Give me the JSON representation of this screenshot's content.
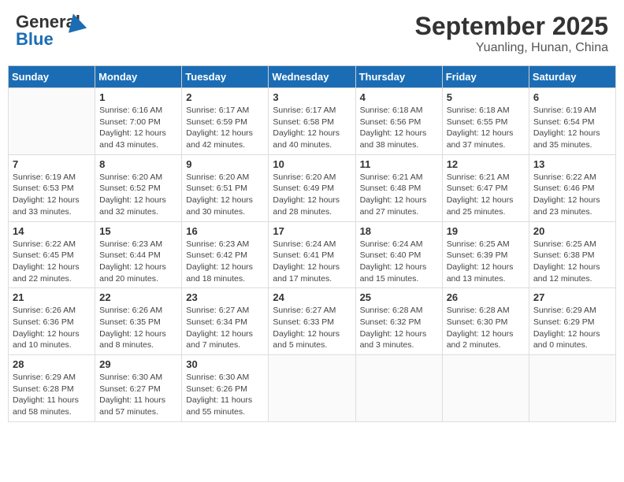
{
  "header": {
    "logo_general": "General",
    "logo_blue": "Blue",
    "title": "September 2025",
    "subtitle": "Yuanling, Hunan, China"
  },
  "weekdays": [
    "Sunday",
    "Monday",
    "Tuesday",
    "Wednesday",
    "Thursday",
    "Friday",
    "Saturday"
  ],
  "weeks": [
    [
      {
        "day": "",
        "detail": ""
      },
      {
        "day": "1",
        "detail": "Sunrise: 6:16 AM\nSunset: 7:00 PM\nDaylight: 12 hours\nand 43 minutes."
      },
      {
        "day": "2",
        "detail": "Sunrise: 6:17 AM\nSunset: 6:59 PM\nDaylight: 12 hours\nand 42 minutes."
      },
      {
        "day": "3",
        "detail": "Sunrise: 6:17 AM\nSunset: 6:58 PM\nDaylight: 12 hours\nand 40 minutes."
      },
      {
        "day": "4",
        "detail": "Sunrise: 6:18 AM\nSunset: 6:56 PM\nDaylight: 12 hours\nand 38 minutes."
      },
      {
        "day": "5",
        "detail": "Sunrise: 6:18 AM\nSunset: 6:55 PM\nDaylight: 12 hours\nand 37 minutes."
      },
      {
        "day": "6",
        "detail": "Sunrise: 6:19 AM\nSunset: 6:54 PM\nDaylight: 12 hours\nand 35 minutes."
      }
    ],
    [
      {
        "day": "7",
        "detail": "Sunrise: 6:19 AM\nSunset: 6:53 PM\nDaylight: 12 hours\nand 33 minutes."
      },
      {
        "day": "8",
        "detail": "Sunrise: 6:20 AM\nSunset: 6:52 PM\nDaylight: 12 hours\nand 32 minutes."
      },
      {
        "day": "9",
        "detail": "Sunrise: 6:20 AM\nSunset: 6:51 PM\nDaylight: 12 hours\nand 30 minutes."
      },
      {
        "day": "10",
        "detail": "Sunrise: 6:20 AM\nSunset: 6:49 PM\nDaylight: 12 hours\nand 28 minutes."
      },
      {
        "day": "11",
        "detail": "Sunrise: 6:21 AM\nSunset: 6:48 PM\nDaylight: 12 hours\nand 27 minutes."
      },
      {
        "day": "12",
        "detail": "Sunrise: 6:21 AM\nSunset: 6:47 PM\nDaylight: 12 hours\nand 25 minutes."
      },
      {
        "day": "13",
        "detail": "Sunrise: 6:22 AM\nSunset: 6:46 PM\nDaylight: 12 hours\nand 23 minutes."
      }
    ],
    [
      {
        "day": "14",
        "detail": "Sunrise: 6:22 AM\nSunset: 6:45 PM\nDaylight: 12 hours\nand 22 minutes."
      },
      {
        "day": "15",
        "detail": "Sunrise: 6:23 AM\nSunset: 6:44 PM\nDaylight: 12 hours\nand 20 minutes."
      },
      {
        "day": "16",
        "detail": "Sunrise: 6:23 AM\nSunset: 6:42 PM\nDaylight: 12 hours\nand 18 minutes."
      },
      {
        "day": "17",
        "detail": "Sunrise: 6:24 AM\nSunset: 6:41 PM\nDaylight: 12 hours\nand 17 minutes."
      },
      {
        "day": "18",
        "detail": "Sunrise: 6:24 AM\nSunset: 6:40 PM\nDaylight: 12 hours\nand 15 minutes."
      },
      {
        "day": "19",
        "detail": "Sunrise: 6:25 AM\nSunset: 6:39 PM\nDaylight: 12 hours\nand 13 minutes."
      },
      {
        "day": "20",
        "detail": "Sunrise: 6:25 AM\nSunset: 6:38 PM\nDaylight: 12 hours\nand 12 minutes."
      }
    ],
    [
      {
        "day": "21",
        "detail": "Sunrise: 6:26 AM\nSunset: 6:36 PM\nDaylight: 12 hours\nand 10 minutes."
      },
      {
        "day": "22",
        "detail": "Sunrise: 6:26 AM\nSunset: 6:35 PM\nDaylight: 12 hours\nand 8 minutes."
      },
      {
        "day": "23",
        "detail": "Sunrise: 6:27 AM\nSunset: 6:34 PM\nDaylight: 12 hours\nand 7 minutes."
      },
      {
        "day": "24",
        "detail": "Sunrise: 6:27 AM\nSunset: 6:33 PM\nDaylight: 12 hours\nand 5 minutes."
      },
      {
        "day": "25",
        "detail": "Sunrise: 6:28 AM\nSunset: 6:32 PM\nDaylight: 12 hours\nand 3 minutes."
      },
      {
        "day": "26",
        "detail": "Sunrise: 6:28 AM\nSunset: 6:30 PM\nDaylight: 12 hours\nand 2 minutes."
      },
      {
        "day": "27",
        "detail": "Sunrise: 6:29 AM\nSunset: 6:29 PM\nDaylight: 12 hours\nand 0 minutes."
      }
    ],
    [
      {
        "day": "28",
        "detail": "Sunrise: 6:29 AM\nSunset: 6:28 PM\nDaylight: 11 hours\nand 58 minutes."
      },
      {
        "day": "29",
        "detail": "Sunrise: 6:30 AM\nSunset: 6:27 PM\nDaylight: 11 hours\nand 57 minutes."
      },
      {
        "day": "30",
        "detail": "Sunrise: 6:30 AM\nSunset: 6:26 PM\nDaylight: 11 hours\nand 55 minutes."
      },
      {
        "day": "",
        "detail": ""
      },
      {
        "day": "",
        "detail": ""
      },
      {
        "day": "",
        "detail": ""
      },
      {
        "day": "",
        "detail": ""
      }
    ]
  ]
}
